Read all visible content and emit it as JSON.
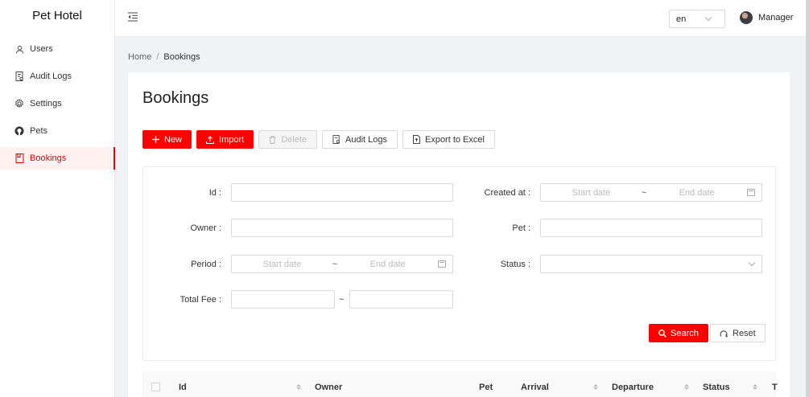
{
  "app": {
    "title": "Pet Hotel"
  },
  "sidebar": {
    "items": [
      {
        "label": "Users",
        "icon": "user-icon"
      },
      {
        "label": "Audit Logs",
        "icon": "audit-icon"
      },
      {
        "label": "Settings",
        "icon": "gear-icon"
      },
      {
        "label": "Pets",
        "icon": "github-icon"
      },
      {
        "label": "Bookings",
        "icon": "book-icon",
        "active": true
      }
    ]
  },
  "header": {
    "language": "en",
    "user": "Manager"
  },
  "breadcrumb": {
    "home": "Home",
    "separator": "/",
    "current": "Bookings"
  },
  "page": {
    "title": "Bookings"
  },
  "toolbar": {
    "new": "New",
    "import": "Import",
    "delete": "Delete",
    "audit_logs": "Audit Logs",
    "export": "Export to Excel"
  },
  "filters": {
    "id": {
      "label": "Id",
      "value": ""
    },
    "owner": {
      "label": "Owner",
      "value": ""
    },
    "period": {
      "label": "Period",
      "start_placeholder": "Start date",
      "end_placeholder": "End date"
    },
    "total_fee": {
      "label": "Total Fee",
      "tilde": "~"
    },
    "created_at": {
      "label": "Created at",
      "start_placeholder": "Start date",
      "end_placeholder": "End date"
    },
    "pet": {
      "label": "Pet",
      "value": ""
    },
    "status": {
      "label": "Status",
      "value": ""
    },
    "range_separator": "~",
    "label_suffix": ":",
    "search": "Search",
    "reset": "Reset"
  },
  "table": {
    "columns": [
      "Id",
      "Owner",
      "Pet",
      "Arrival",
      "Departure",
      "Status",
      "T"
    ]
  },
  "colors": {
    "accent": "#ff0000",
    "active_bg": "#fff1f0"
  }
}
